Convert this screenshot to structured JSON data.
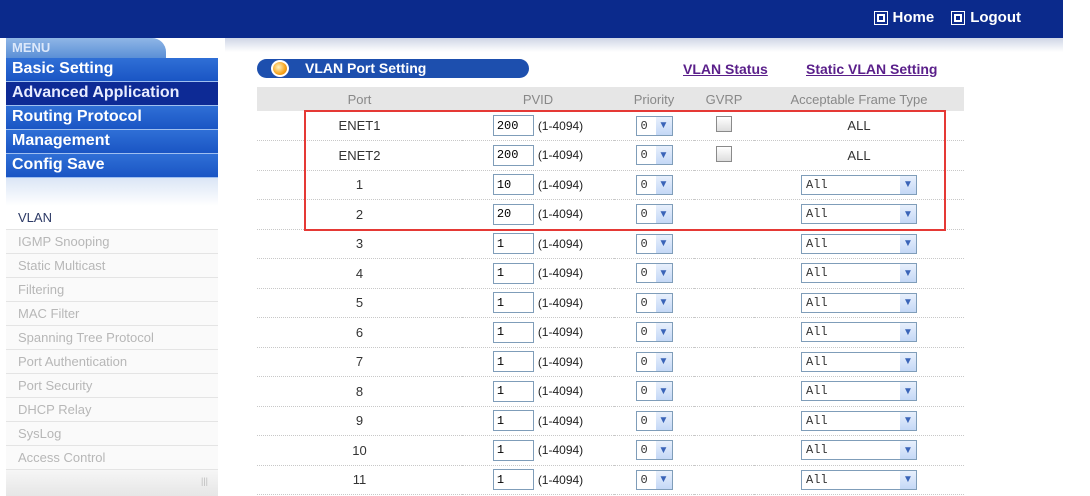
{
  "header": {
    "home_label": "Home",
    "logout_label": "Logout"
  },
  "sidebar": {
    "menu_label": "MENU",
    "main_items": [
      {
        "label": "Basic Setting"
      },
      {
        "label": "Advanced Application"
      },
      {
        "label": "Routing Protocol"
      },
      {
        "label": "Management"
      },
      {
        "label": "Config Save"
      }
    ],
    "sub_items": [
      {
        "label": "VLAN"
      },
      {
        "label": "IGMP Snooping"
      },
      {
        "label": "Static Multicast"
      },
      {
        "label": "Filtering"
      },
      {
        "label": "MAC Filter"
      },
      {
        "label": "Spanning Tree Protocol"
      },
      {
        "label": "Port Authentication"
      },
      {
        "label": "Port Security"
      },
      {
        "label": "DHCP Relay"
      },
      {
        "label": "SysLog"
      },
      {
        "label": "Access Control"
      }
    ]
  },
  "page": {
    "title": "VLAN Port Setting",
    "link_vlan_status": "VLAN Status",
    "link_static_vlan": "Static VLAN Setting"
  },
  "table": {
    "headers": {
      "port": "Port",
      "pvid": "PVID",
      "priority": "Priority",
      "gvrp": "GVRP",
      "aft": "Acceptable Frame Type"
    },
    "rows": [
      {
        "port": "ENET1",
        "pvid": "200",
        "range": "(1-4094)",
        "priority": "0",
        "aft": "ALL"
      },
      {
        "port": "ENET2",
        "pvid": "200",
        "range": "(1-4094)",
        "priority": "0",
        "aft": "ALL"
      },
      {
        "port": "1",
        "pvid": "10",
        "range": "(1-4094)",
        "priority": "0",
        "aft": "All"
      },
      {
        "port": "2",
        "pvid": "20",
        "range": "(1-4094)",
        "priority": "0",
        "aft": "All"
      },
      {
        "port": "3",
        "pvid": "1",
        "range": "(1-4094)",
        "priority": "0",
        "aft": "All"
      },
      {
        "port": "4",
        "pvid": "1",
        "range": "(1-4094)",
        "priority": "0",
        "aft": "All"
      },
      {
        "port": "5",
        "pvid": "1",
        "range": "(1-4094)",
        "priority": "0",
        "aft": "All"
      },
      {
        "port": "6",
        "pvid": "1",
        "range": "(1-4094)",
        "priority": "0",
        "aft": "All"
      },
      {
        "port": "7",
        "pvid": "1",
        "range": "(1-4094)",
        "priority": "0",
        "aft": "All"
      },
      {
        "port": "8",
        "pvid": "1",
        "range": "(1-4094)",
        "priority": "0",
        "aft": "All"
      },
      {
        "port": "9",
        "pvid": "1",
        "range": "(1-4094)",
        "priority": "0",
        "aft": "All"
      },
      {
        "port": "10",
        "pvid": "1",
        "range": "(1-4094)",
        "priority": "0",
        "aft": "All"
      },
      {
        "port": "11",
        "pvid": "1",
        "range": "(1-4094)",
        "priority": "0",
        "aft": "All"
      }
    ]
  },
  "colors": {
    "header_bar": "#0b2a8c",
    "menu_blue": "#1a55c4",
    "highlight_box": "#e53935"
  }
}
